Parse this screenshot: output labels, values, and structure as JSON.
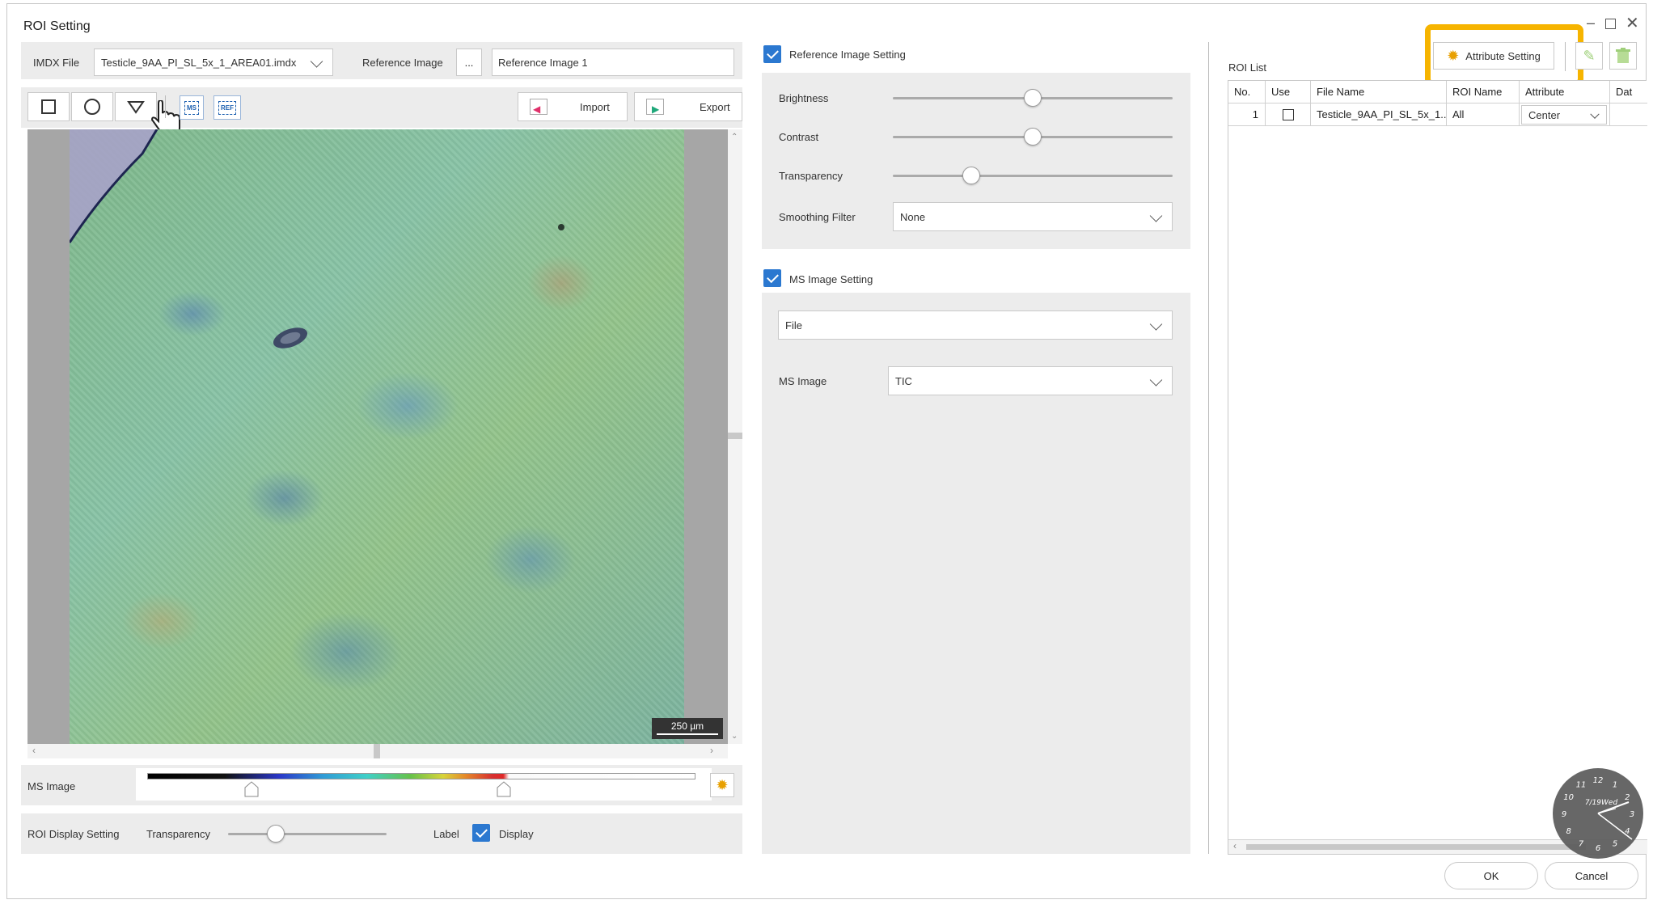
{
  "window": {
    "title": "ROI Setting"
  },
  "top_bar": {
    "imdx_label": "IMDX File",
    "imdx_value": "Testicle_9AA_PI_SL_5x_1_AREA01.imdx",
    "ref_label": "Reference Image",
    "browse_label": "...",
    "ref_value": "Reference Image 1"
  },
  "toolbar": {
    "ms_badge": "MS",
    "ref_badge": "REF",
    "import_label": "Import",
    "export_label": "Export"
  },
  "image": {
    "scale_bar": "250 µm"
  },
  "ms_image_bar": {
    "label": "MS Image",
    "lower_level": 0.19,
    "upper_level": 0.65
  },
  "roi_display": {
    "label": "ROI Display Setting",
    "transparency_label": "Transparency",
    "transparency_level": 0.3,
    "label_label": "Label",
    "display_label": "Display",
    "display_checked": true
  },
  "reference_setting": {
    "title": "Reference Image Setting",
    "checked": true,
    "brightness_label": "Brightness",
    "brightness_level": 0.5,
    "contrast_label": "Contrast",
    "contrast_level": 0.5,
    "transparency_label": "Transparency",
    "transparency_level": 0.28,
    "smoothing_label": "Smoothing Filter",
    "smoothing_value": "None"
  },
  "ms_setting": {
    "title": "MS Image Setting",
    "checked": true,
    "source_value": "File",
    "ms_image_label": "MS Image",
    "ms_image_value": "TIC"
  },
  "roi_list": {
    "title": "ROI List",
    "attribute_button": "Attribute Setting",
    "columns": [
      "No.",
      "Use",
      "File Name",
      "ROI Name",
      "Attribute",
      "Dat"
    ],
    "rows": [
      {
        "no": "1",
        "use": false,
        "file": "Testicle_9AA_PI_SL_5x_1...",
        "roi": "All",
        "attribute": "Center"
      }
    ]
  },
  "footer": {
    "ok": "OK",
    "cancel": "Cancel"
  },
  "clock": {
    "date_text": "7/19Wed",
    "numbers": [
      "12",
      "1",
      "2",
      "3",
      "4",
      "5",
      "6",
      "7",
      "8",
      "9",
      "10",
      "11"
    ]
  },
  "colors": {
    "accent": "#2b78d0",
    "highlight": "#f6b400"
  }
}
